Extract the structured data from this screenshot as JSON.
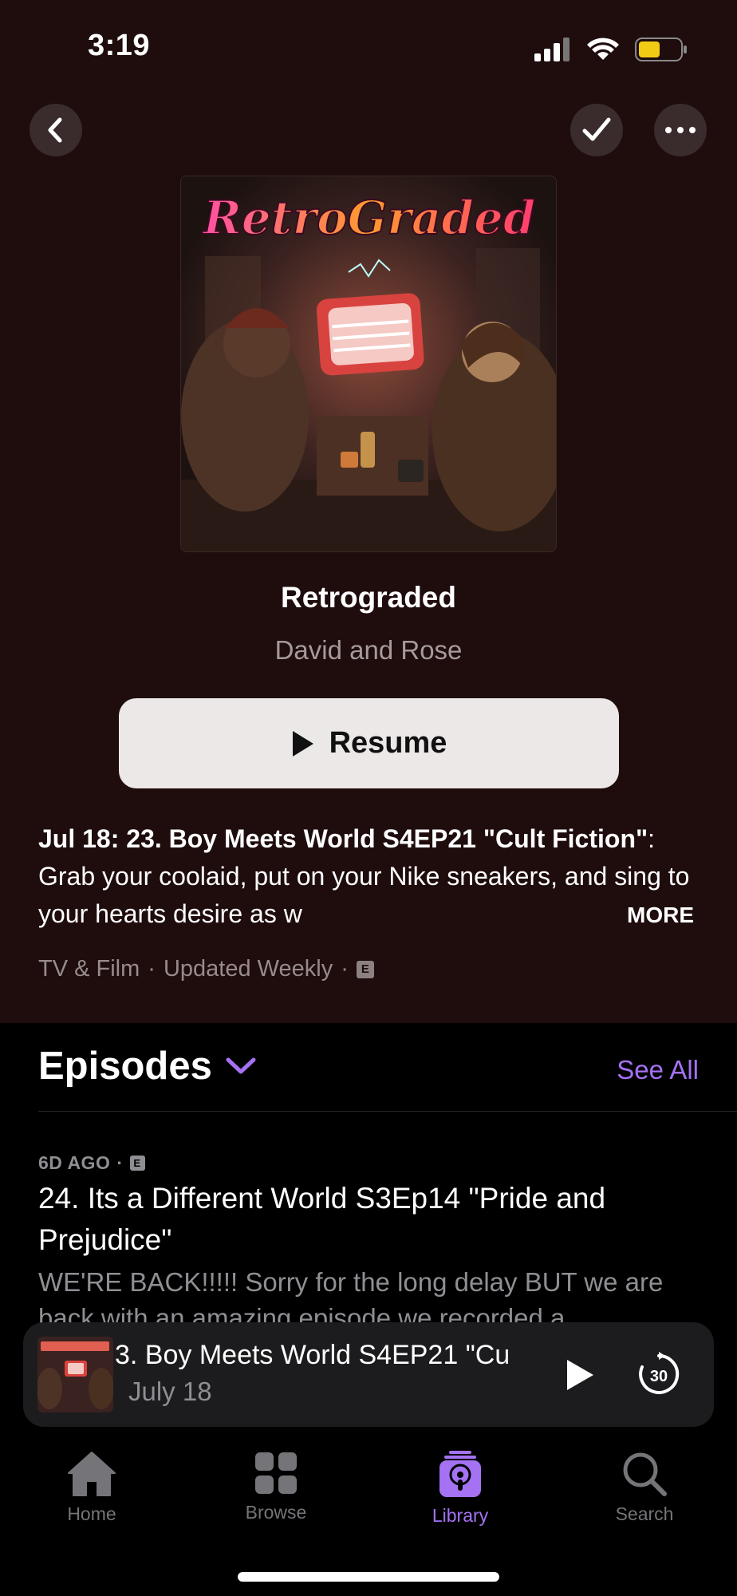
{
  "status_bar": {
    "time": "3:19"
  },
  "nav": {
    "back_icon": "chevron-left-icon",
    "check_icon": "checkmark-icon",
    "more_icon": "ellipsis-icon"
  },
  "show": {
    "artwork_text": "RetroGraded",
    "title": "Retrograded",
    "author": "David and Rose",
    "resume_label": "Resume",
    "description_bold": "Jul 18: 23. Boy Meets World S4EP21 \"Cult Fiction\"",
    "description_rest": ": Grab your coolaid, put on your Nike sneakers, and sing to your hearts desire as w",
    "more_label": "MORE",
    "category": "TV & Film",
    "frequency": "Updated Weekly",
    "explicit": "E"
  },
  "episodes": {
    "title": "Episodes",
    "see_all": "See All",
    "items": [
      {
        "age": "6D AGO",
        "explicit": "E",
        "title": "24. Its a Different World S3Ep14 \"Pride and Prejudice\"",
        "summary": "WE'RE BACK!!!!! Sorry for the long delay BUT we are back with an amazing episode we recorded a"
      }
    ]
  },
  "mini_player": {
    "title": "3. Boy Meets World S4EP21 \"Cu",
    "subtitle": "July 18",
    "skip_value": "30"
  },
  "tabs": [
    {
      "label": "Home",
      "icon": "home-icon",
      "active": false
    },
    {
      "label": "Browse",
      "icon": "grid-icon",
      "active": false
    },
    {
      "label": "Library",
      "icon": "podcast-library-icon",
      "active": true
    },
    {
      "label": "Search",
      "icon": "search-icon",
      "active": false
    }
  ],
  "colors": {
    "accent": "#a472f2",
    "hero_background": "#1f0c0d",
    "resume_button": "#ece8e8"
  }
}
